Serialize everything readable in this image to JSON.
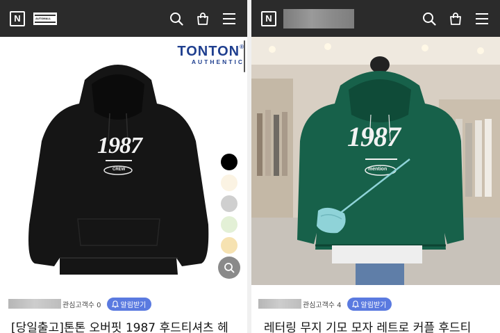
{
  "left": {
    "header": {
      "logo": "N",
      "store_logo_text": "AUTOMALL"
    },
    "brand": {
      "name": "TONTON",
      "sub": "AUTHENTIC",
      "registered": "®"
    },
    "product_graphic": {
      "number": "1987",
      "tag": "CREW"
    },
    "swatches": [
      {
        "name": "black",
        "color": "#000000"
      },
      {
        "name": "cream",
        "color": "#fbf3e3"
      },
      {
        "name": "gray",
        "color": "#cfcfcf"
      },
      {
        "name": "mint",
        "color": "#e3f0d6"
      },
      {
        "name": "butter",
        "color": "#f6e2b1"
      }
    ],
    "interest_label": "관심고객수 0",
    "notify_label": "알림받기",
    "title": "[당일출고]톤톤 오버핏 1987 후드티셔츠 헤"
  },
  "right": {
    "header": {
      "logo": "N"
    },
    "product_graphic": {
      "number": "1987",
      "tag": "mention"
    },
    "interest_label": "관심고객수 4",
    "notify_label": "알림받기",
    "title": "레터링 무지 기모 모자 레트로 커플 후드티"
  },
  "icons": [
    "search-icon",
    "bag-icon",
    "menu-icon",
    "zoom-icon",
    "bell-icon"
  ],
  "colors": {
    "header_bg": "#2b2b2b",
    "notify_bg": "#5a7ae0",
    "brand": "#1f3f8f",
    "hoodie_green": "#17614a"
  }
}
